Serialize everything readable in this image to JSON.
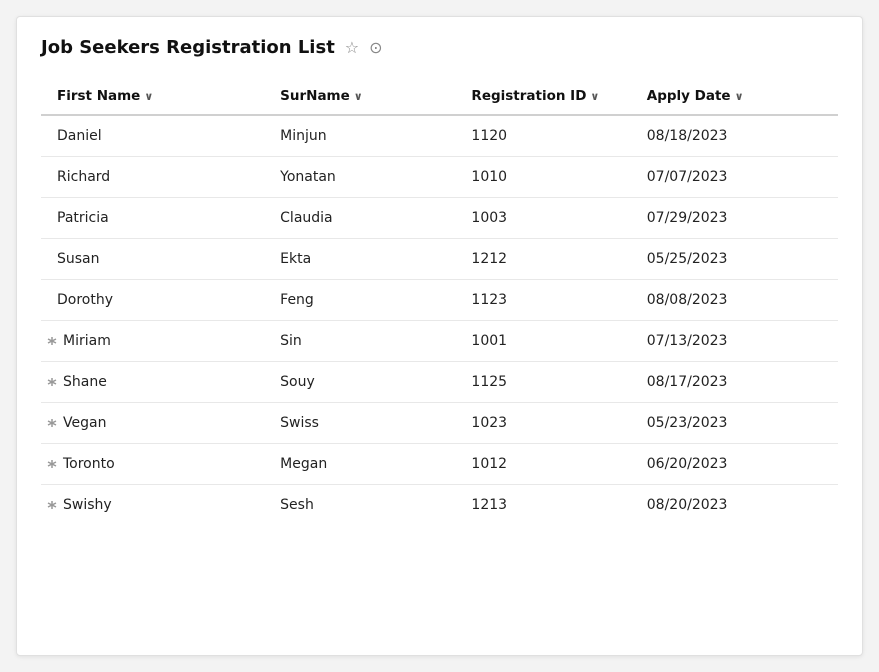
{
  "header": {
    "title": "Job Seekers Registration List",
    "star_icon": "☆",
    "check_icon": "⊙"
  },
  "columns": [
    {
      "key": "firstName",
      "label": "First Name",
      "sort": true
    },
    {
      "key": "surName",
      "label": "SurName",
      "sort": true
    },
    {
      "key": "registrationId",
      "label": "Registration ID",
      "sort": true
    },
    {
      "key": "applyDate",
      "label": "Apply Date",
      "sort": true
    }
  ],
  "rows": [
    {
      "firstName": "Daniel",
      "hasMarker": false,
      "surName": "Minjun",
      "registrationId": "1120",
      "applyDate": "08/18/2023"
    },
    {
      "firstName": "Richard",
      "hasMarker": false,
      "surName": "Yonatan",
      "registrationId": "1010",
      "applyDate": "07/07/2023"
    },
    {
      "firstName": "Patricia",
      "hasMarker": false,
      "surName": "Claudia",
      "registrationId": "1003",
      "applyDate": "07/29/2023"
    },
    {
      "firstName": "Susan",
      "hasMarker": false,
      "surName": "Ekta",
      "registrationId": "1212",
      "applyDate": "05/25/2023"
    },
    {
      "firstName": "Dorothy",
      "hasMarker": false,
      "surName": "Feng",
      "registrationId": "1123",
      "applyDate": "08/08/2023"
    },
    {
      "firstName": "Miriam",
      "hasMarker": true,
      "surName": "Sin",
      "registrationId": "1001",
      "applyDate": "07/13/2023"
    },
    {
      "firstName": "Shane",
      "hasMarker": true,
      "surName": "Souy",
      "registrationId": "1125",
      "applyDate": "08/17/2023"
    },
    {
      "firstName": "Vegan",
      "hasMarker": true,
      "surName": "Swiss",
      "registrationId": "1023",
      "applyDate": "05/23/2023"
    },
    {
      "firstName": "Toronto",
      "hasMarker": true,
      "surName": "Megan",
      "registrationId": "1012",
      "applyDate": "06/20/2023"
    },
    {
      "firstName": "Swishy",
      "hasMarker": true,
      "surName": "Sesh",
      "registrationId": "1213",
      "applyDate": "08/20/2023"
    }
  ],
  "sort_chevron": "∨"
}
